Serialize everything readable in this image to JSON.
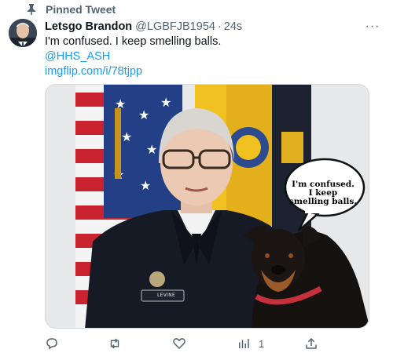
{
  "pinned": {
    "label": "Pinned Tweet"
  },
  "tweet": {
    "display_name": "Letsgo Brandon",
    "handle": "@LGBFJB1954",
    "separator": "·",
    "time": "24s",
    "more_label": "···",
    "text_line": "I'm confused. I keep smelling balls.",
    "mention": "@HHS_ASH",
    "link": "imgflip.com/i/78tjpp"
  },
  "media": {
    "bubble_line1": "I'm confused.",
    "bubble_line2": "I keep",
    "bubble_line3": "smelling balls.",
    "nametag": "LEVINE"
  },
  "actions": {
    "reply_count": "",
    "retweet_count": "",
    "like_count": "",
    "views_count": "1",
    "share_count": ""
  },
  "colors": {
    "link": "#1d9bf0",
    "secondary_text": "#536471",
    "primary_text": "#0f1419"
  },
  "icons": [
    "pin-icon",
    "more-icon",
    "reply-icon",
    "retweet-icon",
    "like-icon",
    "views-icon",
    "share-icon"
  ]
}
